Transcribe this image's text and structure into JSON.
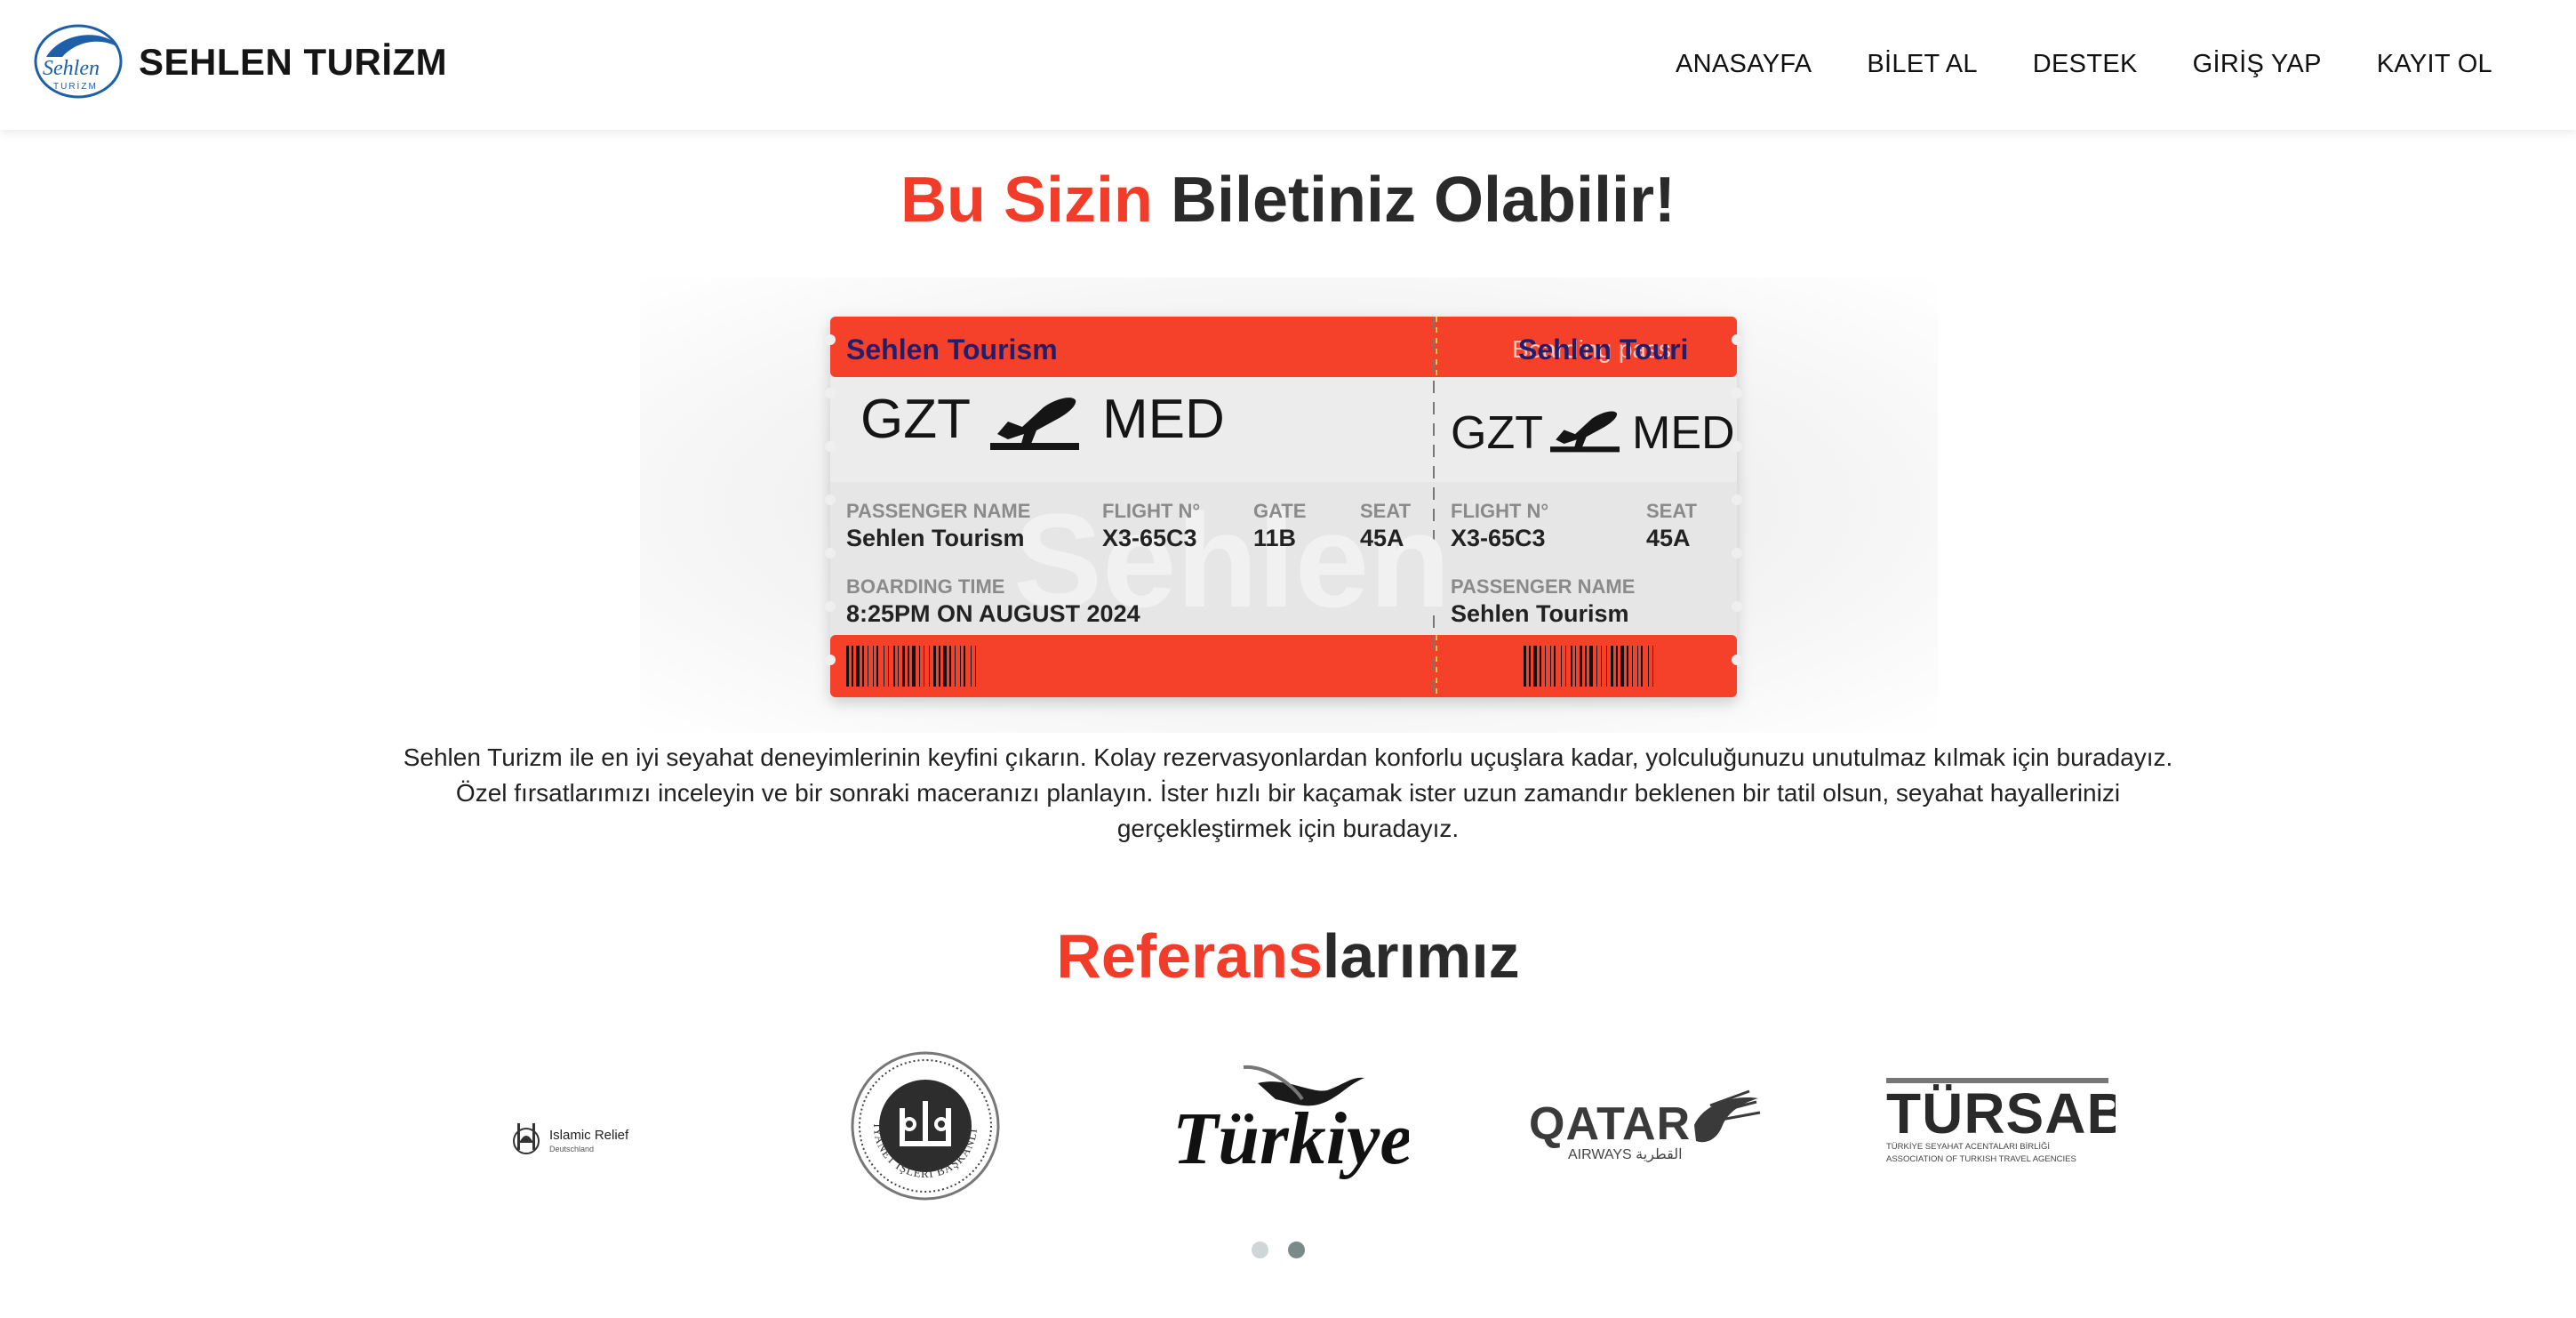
{
  "brand": {
    "name": "SEHLEN TURİZM",
    "logo_text_top": "Sehlen",
    "logo_text_bottom": "TURİZM"
  },
  "nav": {
    "items": [
      "ANASAYFA",
      "BİLET AL",
      "DESTEK",
      "GİRİŞ YAP",
      "KAYIT OL"
    ]
  },
  "hero": {
    "title_accent": "Bu Sizin",
    "title_rest": " Biletiniz Olabilir!"
  },
  "ticket": {
    "company": "Sehlen Tourism",
    "label": "Boarding pass",
    "stub_company": "Sehlen Touri",
    "from": "GZT",
    "to": "MED",
    "watermark": "Sehlen",
    "passenger_label": "PASSENGER NAME",
    "passenger_value": "Sehlen Tourism",
    "flight_label": "FLIGHT N°",
    "flight_value": "X3-65C3",
    "gate_label": "GATE",
    "gate_value": "11B",
    "seat_label": "SEAT",
    "seat_value": "45A",
    "boarding_label": "BOARDING TIME",
    "boarding_value": "8:25PM ON AUGUST 2024",
    "colors": {
      "red": "#f5402a",
      "navy": "#1f1f6e",
      "grey": "#e6e6e6"
    }
  },
  "description": {
    "line1": "Sehlen Turizm ile en iyi seyahat deneyimlerinin keyfini çıkarın. Kolay rezervasyonlardan konforlu uçuşlara kadar, yolculuğunuzu unutulmaz kılmak için buradayız.",
    "line2": "Özel fırsatlarımızı inceleyin ve bir sonraki maceranızı planlayın. İster hızlı bir kaçamak ister uzun zamandır beklenen bir tatil olsun, seyahat hayallerinizi",
    "line3": "gerçekleştirmek için buradayız."
  },
  "references": {
    "title_accent": "Referans",
    "title_rest": "larımız",
    "partners": [
      {
        "name": "Islamic Relief",
        "sub": "Deutschland",
        "icon": "islamic-relief-logo"
      },
      {
        "name": "DİYANET İŞLERİ BAŞKANLIĞI",
        "icon": "diyanet-seal"
      },
      {
        "name": "Türkiye",
        "icon": "turkiye-tourism-logo"
      },
      {
        "name": "QATAR",
        "sub": "AIRWAYS القطرية",
        "icon": "qatar-airways-logo"
      },
      {
        "name": "TÜRSAB",
        "sub": "TÜRKİYE SEYAHAT ACENTALARI BİRLİĞİ",
        "sub2": "ASSOCIATION OF TURKISH TRAVEL AGENCIES",
        "icon": "tursab-logo"
      }
    ],
    "slides": 2,
    "active_slide": 2
  }
}
